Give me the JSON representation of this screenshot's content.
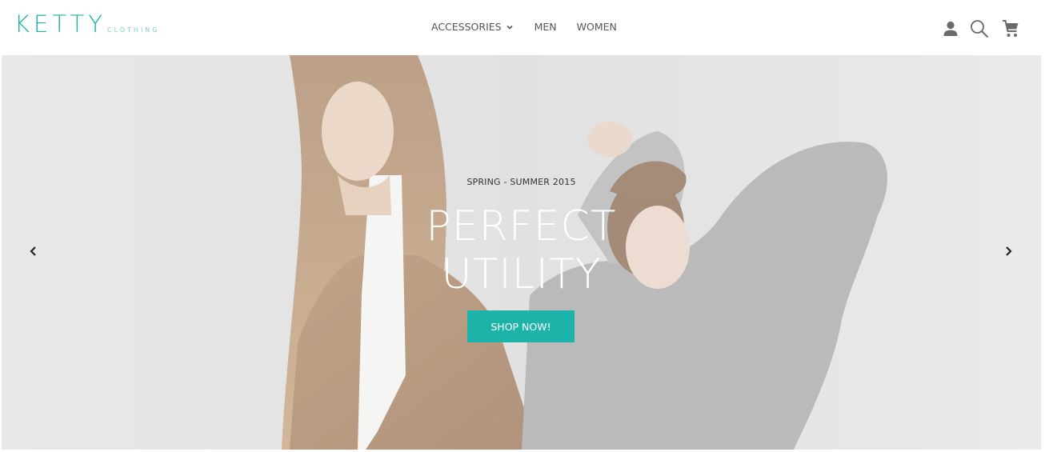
{
  "brand": {
    "name": "KETTY",
    "tagline": "CLOTHING",
    "color": "#1fb0a6"
  },
  "nav": {
    "items": [
      {
        "label": "ACCESSORIES",
        "has_dropdown": true,
        "icon": "chevron-down-icon"
      },
      {
        "label": "MEN"
      },
      {
        "label": "WOMEN"
      }
    ]
  },
  "header_icons": [
    "user-icon",
    "search-icon",
    "cart-icon"
  ],
  "hero": {
    "eyebrow": "SPRING - SUMMER 2015",
    "headline_line1": "PERFECT",
    "headline_line2": "UTILITY",
    "cta_label": "SHOP NOW!",
    "cta_color": "#1db3a8",
    "prev_icon": "chevron-left-icon",
    "next_icon": "chevron-right-icon"
  }
}
